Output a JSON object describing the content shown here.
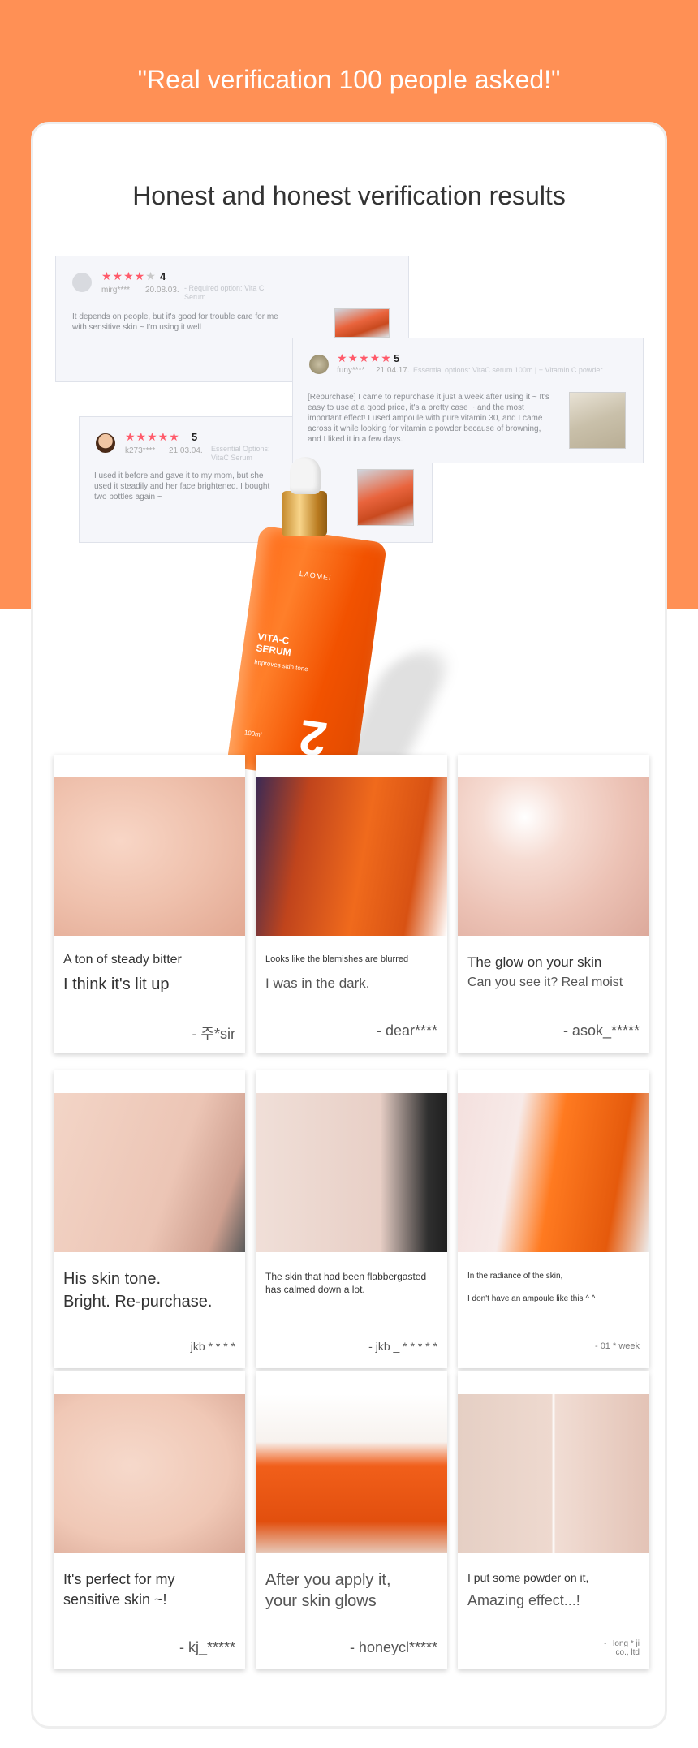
{
  "banner": {
    "headline": "\"Real verification 100 people asked!\"",
    "background_color": "#ff9055"
  },
  "card": {
    "title": "Honest and honest verification results"
  },
  "reviews": [
    {
      "user": "mirg****",
      "date": "20.08.03.",
      "rating": 4,
      "rating_label": "4",
      "option": "- Required option: Vita C Serum",
      "text": "It depends on people, but it's good for trouble care for me with sensitive skin ~ I'm using it well"
    },
    {
      "user": "funy****",
      "date": "21.04.17.",
      "rating": 5,
      "rating_label": "5",
      "option": "Essential options: VitaC serum 100m | + Vitamin C powder...",
      "text": "[Repurchase] I came to repurchase it just a week after using it ~ It's easy to use at a good price, it's a pretty case ~ and the most important effect! I used ampoule with pure vitamin 30, and I came across it while looking for vitamin c powder because of browning, and I liked it in a few days."
    },
    {
      "user": "k273****",
      "date": "21.03.04.",
      "rating": 5,
      "rating_label": "5",
      "option": "Essential Options: VitaC Serum",
      "text": "I used it before and gave it to my mom, but she used it steadily and her face brightened. I bought two bottles again ~"
    }
  ],
  "product": {
    "brand": "LAOMEI",
    "name_line1": "VITA-C",
    "name_line2": "SERUM",
    "tagline": "Improves skin tone",
    "number": "2",
    "volume": "100ml"
  },
  "testimonials": [
    {
      "line1": "A ton of steady bitter",
      "line2": "I think it's lit up",
      "author": "- 주*sir"
    },
    {
      "line1": "Looks like the blemishes are blurred",
      "line2": "I was in the dark.",
      "author": "- dear****"
    },
    {
      "line1": "The glow on your skin",
      "line2": "Can you see it? Real moist",
      "author": "- asok_*****"
    },
    {
      "line1": "His skin tone.",
      "line2": "Bright. Re-purchase.",
      "author": "jkb * * * *"
    },
    {
      "line1": "The skin that had been flabbergasted has calmed down a lot.",
      "line2": "",
      "author": "- jkb _ * * * * *"
    },
    {
      "line1": "In the radiance of the skin,",
      "line2": "I don't have an ampoule like this ^ ^",
      "author": "- 01 * week"
    },
    {
      "line1": "It's perfect for my",
      "line2": "sensitive skin ~!",
      "author": "- kj_*****"
    },
    {
      "line1": "After you apply it,",
      "line2": "your skin glows",
      "author": "- honeycl*****"
    },
    {
      "line1": "I put some powder on it,",
      "line2": "Amazing effect...!",
      "author": "- Hong * ji co., ltd"
    }
  ]
}
